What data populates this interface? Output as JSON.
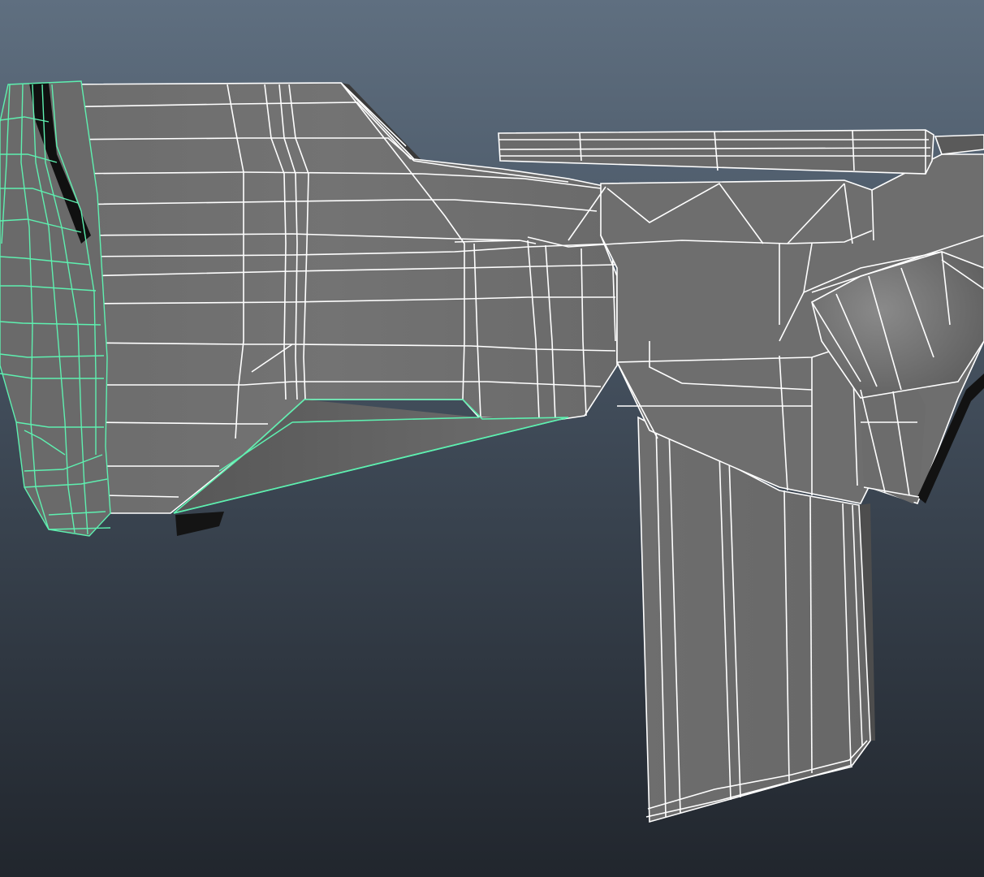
{
  "viewport": {
    "background_top": "#5f6f80",
    "background_mid": "#3e4956",
    "background_bottom": "#21262d",
    "shade_light": "#7c7c7c",
    "shade_mid": "#6a6a6a",
    "shade_dark": "#555555",
    "shadow": "#111111",
    "wire_color": "#ffffff",
    "selected_wire_color": "#5ef0b0"
  },
  "model": {
    "selected_part": "stock-butt",
    "parts": [
      "stock-butt",
      "stock-body",
      "receiver",
      "top-rail",
      "magazine",
      "trigger-group"
    ]
  }
}
